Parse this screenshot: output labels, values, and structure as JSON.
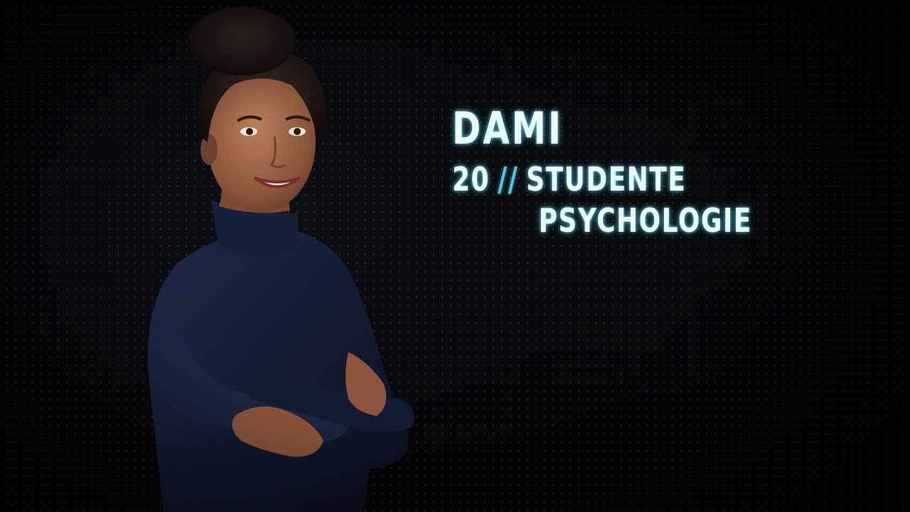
{
  "caption": {
    "name": "DAMI",
    "age": "20",
    "separator": "//",
    "occupation_line1": "STUDENTE",
    "occupation_line2": "PSYCHOLOGIE"
  },
  "colors": {
    "background": "#050608",
    "text_glow": "#eafdff",
    "separator_accent": "#55c6dc",
    "clothing": "#141c33"
  }
}
